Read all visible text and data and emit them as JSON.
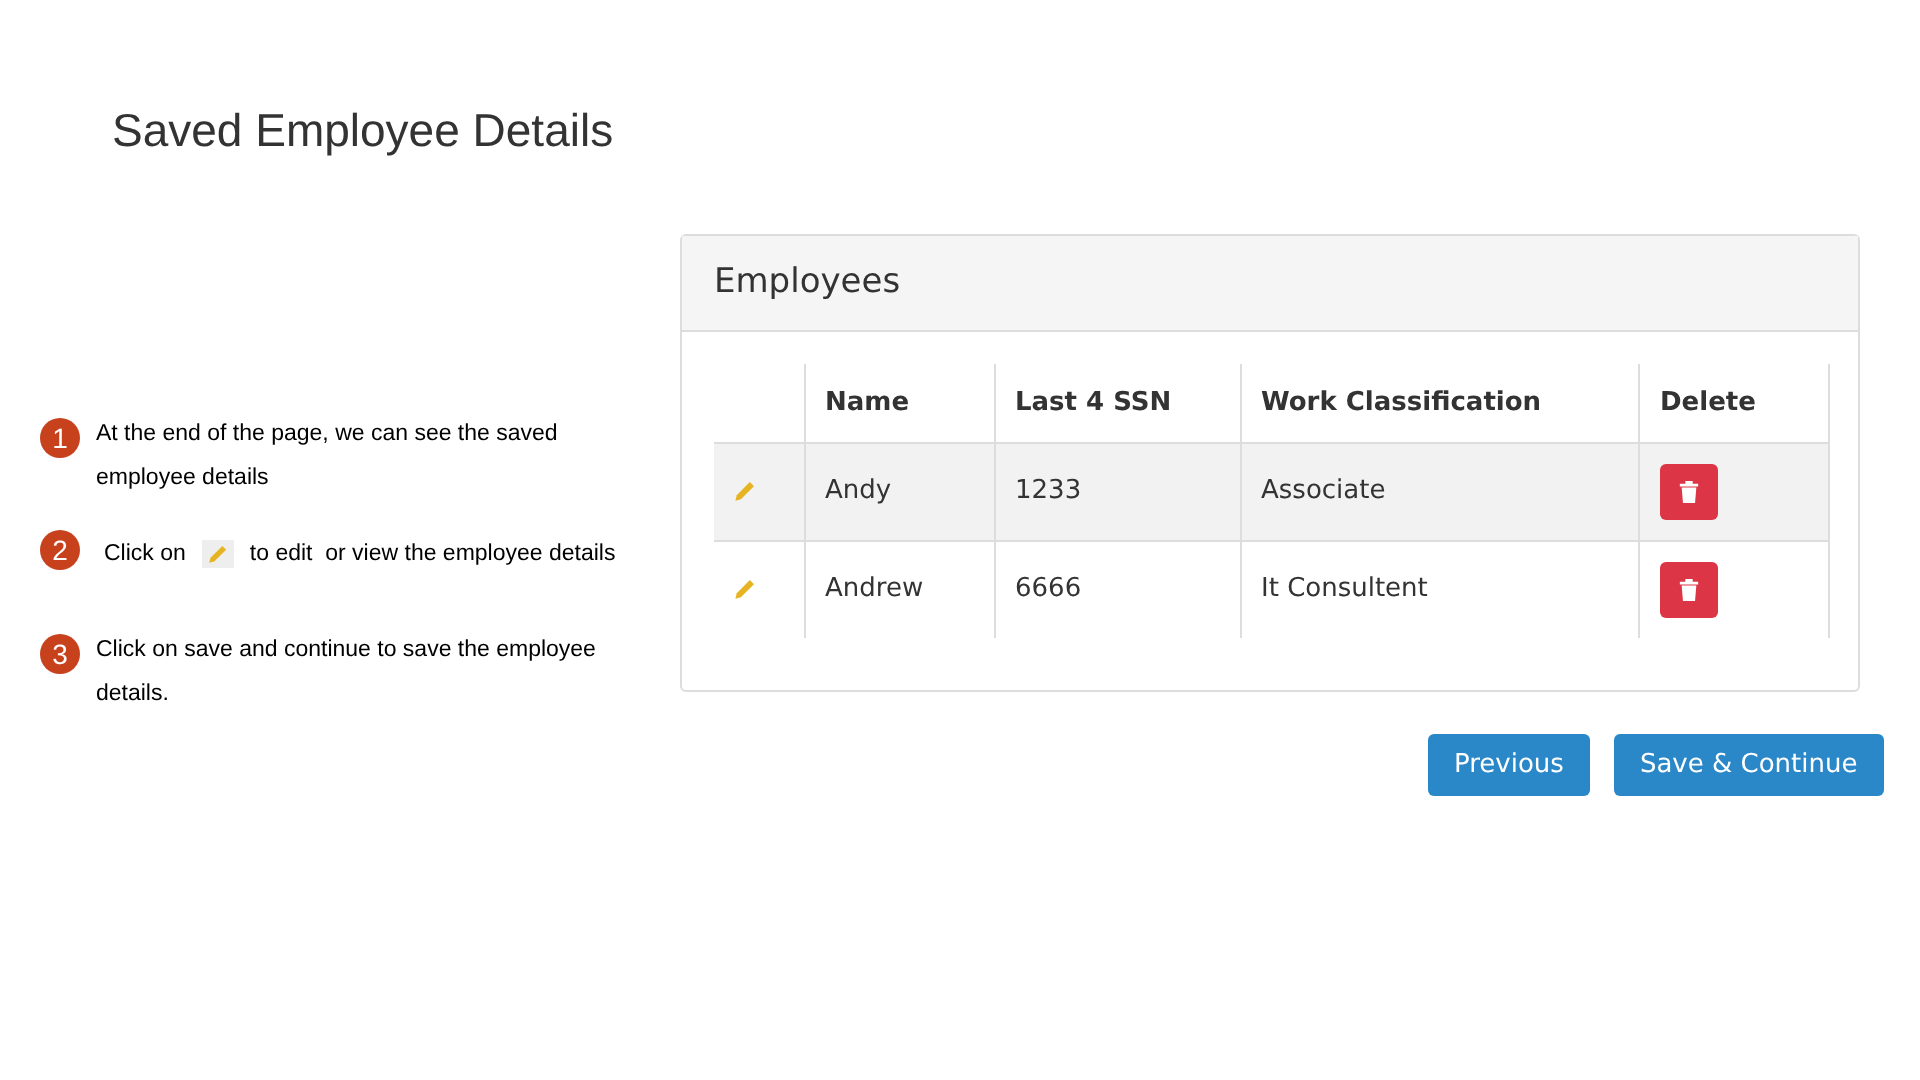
{
  "title": "Saved Employee Details",
  "steps": [
    {
      "number": "1",
      "kind": "text",
      "text": "At the end of the page, we can see the saved employee details"
    },
    {
      "number": "2",
      "kind": "icon_text",
      "before": "Click on",
      "after": "to edit  or view the employee details"
    },
    {
      "number": "3",
      "kind": "text",
      "text": "Click on save and continue to save the employee details."
    }
  ],
  "panel": {
    "title": "Employees",
    "columns": [
      "Name",
      "Last 4 SSN",
      "Work Classification",
      "Delete"
    ],
    "rows": [
      {
        "name": "Andy",
        "ssn": "1233",
        "classification": "Associate"
      },
      {
        "name": "Andrew",
        "ssn": "6666",
        "classification": "It Consultent"
      }
    ]
  },
  "buttons": [
    "Previous",
    "Save & Continue"
  ]
}
